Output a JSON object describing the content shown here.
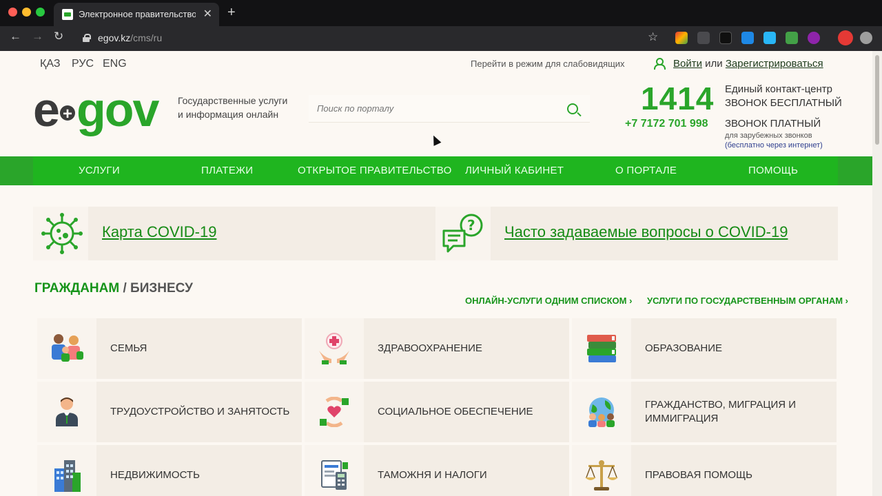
{
  "browser": {
    "tab_title": "Электронное правительство",
    "tab_favicon": "egov-favicon-icon",
    "new_tab": "+",
    "close_tab": "✕",
    "url_host": "egov.kz",
    "url_path": "/cms/ru",
    "colors": {
      "close": "#ff5f57",
      "minimize": "#febc2e",
      "maximize": "#28c840"
    }
  },
  "topbar": {
    "languages": [
      "ҚАЗ",
      "РУС",
      "ENG"
    ],
    "vision_mode": "Перейти в режим для слабовидящих",
    "login": "Войти",
    "or": "или",
    "register": "Зарегистрироваться"
  },
  "header": {
    "logo_e": "e",
    "logo_gov": "gov",
    "tagline_1": "Государственные услуги",
    "tagline_2": "и информация онлайн",
    "search_placeholder": "Поиск по порталу",
    "contact_number": "1414",
    "contact_line1": "Единый контакт-центр",
    "contact_line2": "ЗВОНОК БЕСПЛАТНЫЙ",
    "phone": "+7 7172 701 998",
    "paid_line1": "ЗВОНОК ПЛАТНЫЙ",
    "paid_line2": "для зарубежных звонков",
    "paid_line3": "(бесплатно через интернет)"
  },
  "nav": {
    "items": [
      "УСЛУГИ",
      "ПЛАТЕЖИ",
      "ОТКРЫТОЕ ПРАВИТЕЛЬСТВО",
      "ЛИЧНЫЙ КАБИНЕТ",
      "О ПОРТАЛЕ",
      "ПОМОЩЬ"
    ]
  },
  "banners": {
    "covid_map": "Карта COVID-19",
    "covid_faq": "Часто задаваемые вопросы о COVID-19"
  },
  "section": {
    "citizens": "ГРАЖДАНАМ",
    "separator": "/",
    "business": "БИЗНЕСУ",
    "online_services": "ОНЛАЙН-УСЛУГИ ОДНИМ СПИСКОМ ›",
    "by_agency": "УСЛУГИ ПО ГОСУДАРСТВЕННЫМ ОРГАНАМ ›"
  },
  "categories": [
    {
      "label": "СЕМЬЯ",
      "icon": "family-icon"
    },
    {
      "label": "ЗДРАВООХРАНЕНИЕ",
      "icon": "healthcare-icon"
    },
    {
      "label": "ОБРАЗОВАНИЕ",
      "icon": "books-icon"
    },
    {
      "label": "ТРУДОУСТРОЙСТВО И ЗАНЯТОСТЬ",
      "icon": "employee-icon"
    },
    {
      "label": "СОЦИАЛЬНОЕ ОБЕСПЕЧЕНИЕ",
      "icon": "social-care-icon"
    },
    {
      "label": "ГРАЖДАНСТВО, МИГРАЦИЯ И ИММИГРАЦИЯ",
      "icon": "globe-people-icon"
    },
    {
      "label": "НЕДВИЖИМОСТЬ",
      "icon": "buildings-icon"
    },
    {
      "label": "ТАМОЖНЯ И НАЛОГИ",
      "icon": "tax-document-icon"
    },
    {
      "label": "ПРАВОВАЯ ПОМОЩЬ",
      "icon": "scales-icon"
    }
  ]
}
